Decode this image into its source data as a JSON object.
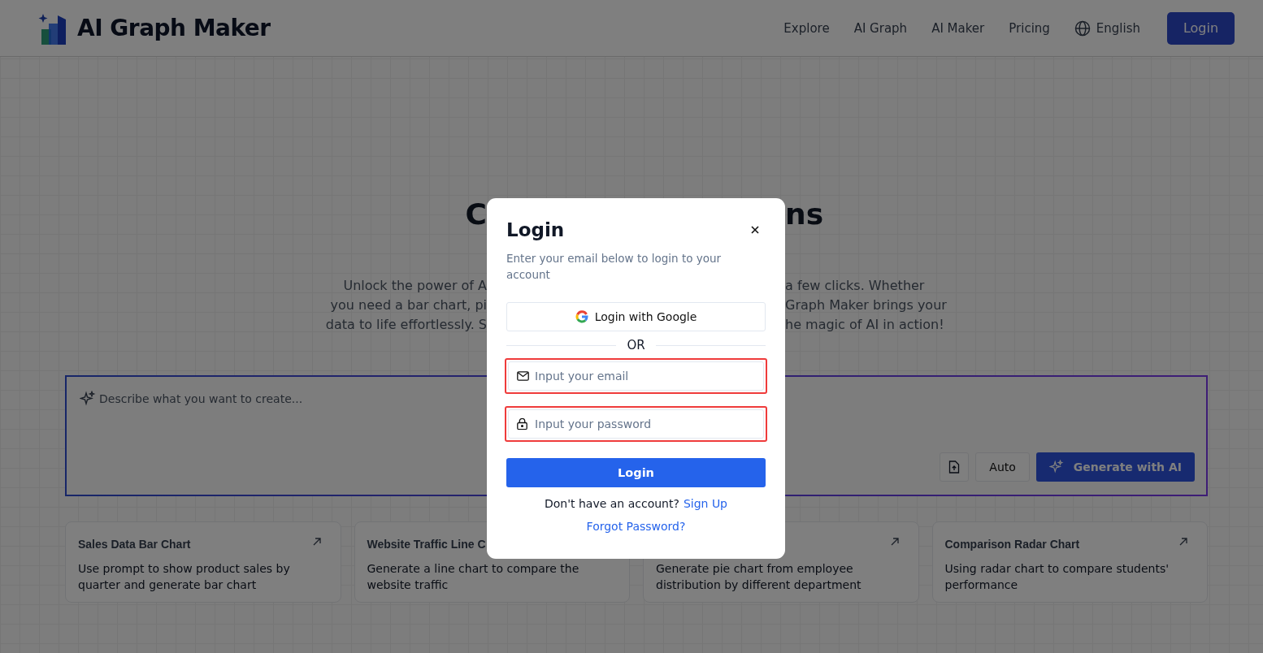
{
  "header": {
    "brand": "AI Graph Maker",
    "nav": [
      {
        "label": "Explore"
      },
      {
        "label": "AI Graph"
      },
      {
        "label": "AI Maker"
      },
      {
        "label": "Pricing"
      }
    ],
    "language": "English",
    "login_button": "Login"
  },
  "hero": {
    "title_left": "C",
    "title_right": "ns",
    "intro_left": [
      "Unlock the power of A",
      "you need a bar chart, pi",
      "data to life effortlessly. S"
    ],
    "intro_right": [
      "a few clicks. Whether",
      "Graph Maker brings your",
      "he magic of AI in action!"
    ]
  },
  "prompt": {
    "placeholder": "Describe what you want to create...",
    "mode_button": "Auto",
    "generate_button": "Generate with AI"
  },
  "examples": [
    {
      "title": "Sales Data Bar Chart",
      "text": "Use prompt to show product sales by quarter and generate bar chart",
      "arrow": true
    },
    {
      "title": "Website Traffic Line C",
      "text": "Generate a line chart to compare the website traffic",
      "arrow": false
    },
    {
      "text": "Generate pie chart from employee distribution by different department",
      "arrow": true
    },
    {
      "title": "Comparison Radar Chart",
      "text": "Using radar chart to compare students' performance",
      "arrow": true
    }
  ],
  "login": {
    "title": "Login",
    "subtitle": "Enter your email below to login to your account",
    "google_button": "Login with Google",
    "divider": "OR",
    "fields": [
      {
        "kind": "email",
        "placeholder": "Input your email",
        "highlighted": true
      },
      {
        "kind": "password",
        "placeholder": "Input your password",
        "highlighted": true
      }
    ],
    "submit_button": "Login",
    "signup_prompt": "Don't have an account?",
    "signup_link": "Sign Up",
    "forgot_link": "Forgot Password?"
  }
}
